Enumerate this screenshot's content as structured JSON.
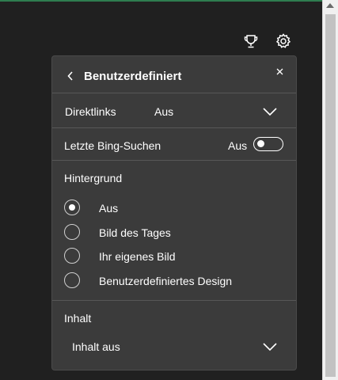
{
  "panel": {
    "title": "Benutzerdefiniert",
    "back_icon": "chevron-left-icon",
    "close_icon": "close-icon"
  },
  "top_icons": [
    "trophy-icon",
    "gear-icon"
  ],
  "direktlinks": {
    "label": "Direktlinks",
    "value": "Aus"
  },
  "bing": {
    "label": "Letzte Bing-Suchen",
    "state_label": "Aus",
    "on": false
  },
  "hintergrund": {
    "title": "Hintergrund",
    "options": [
      {
        "label": "Aus",
        "selected": true
      },
      {
        "label": "Bild des Tages",
        "selected": false
      },
      {
        "label": "Ihr eigenes Bild",
        "selected": false
      },
      {
        "label": "Benutzerdefiniertes Design",
        "selected": false
      }
    ]
  },
  "inhalt": {
    "title": "Inhalt",
    "value": "Inhalt aus"
  },
  "colors": {
    "panel_bg": "#3b3b3b",
    "page_bg": "#202020",
    "accent_top": "#2e7d4f"
  }
}
